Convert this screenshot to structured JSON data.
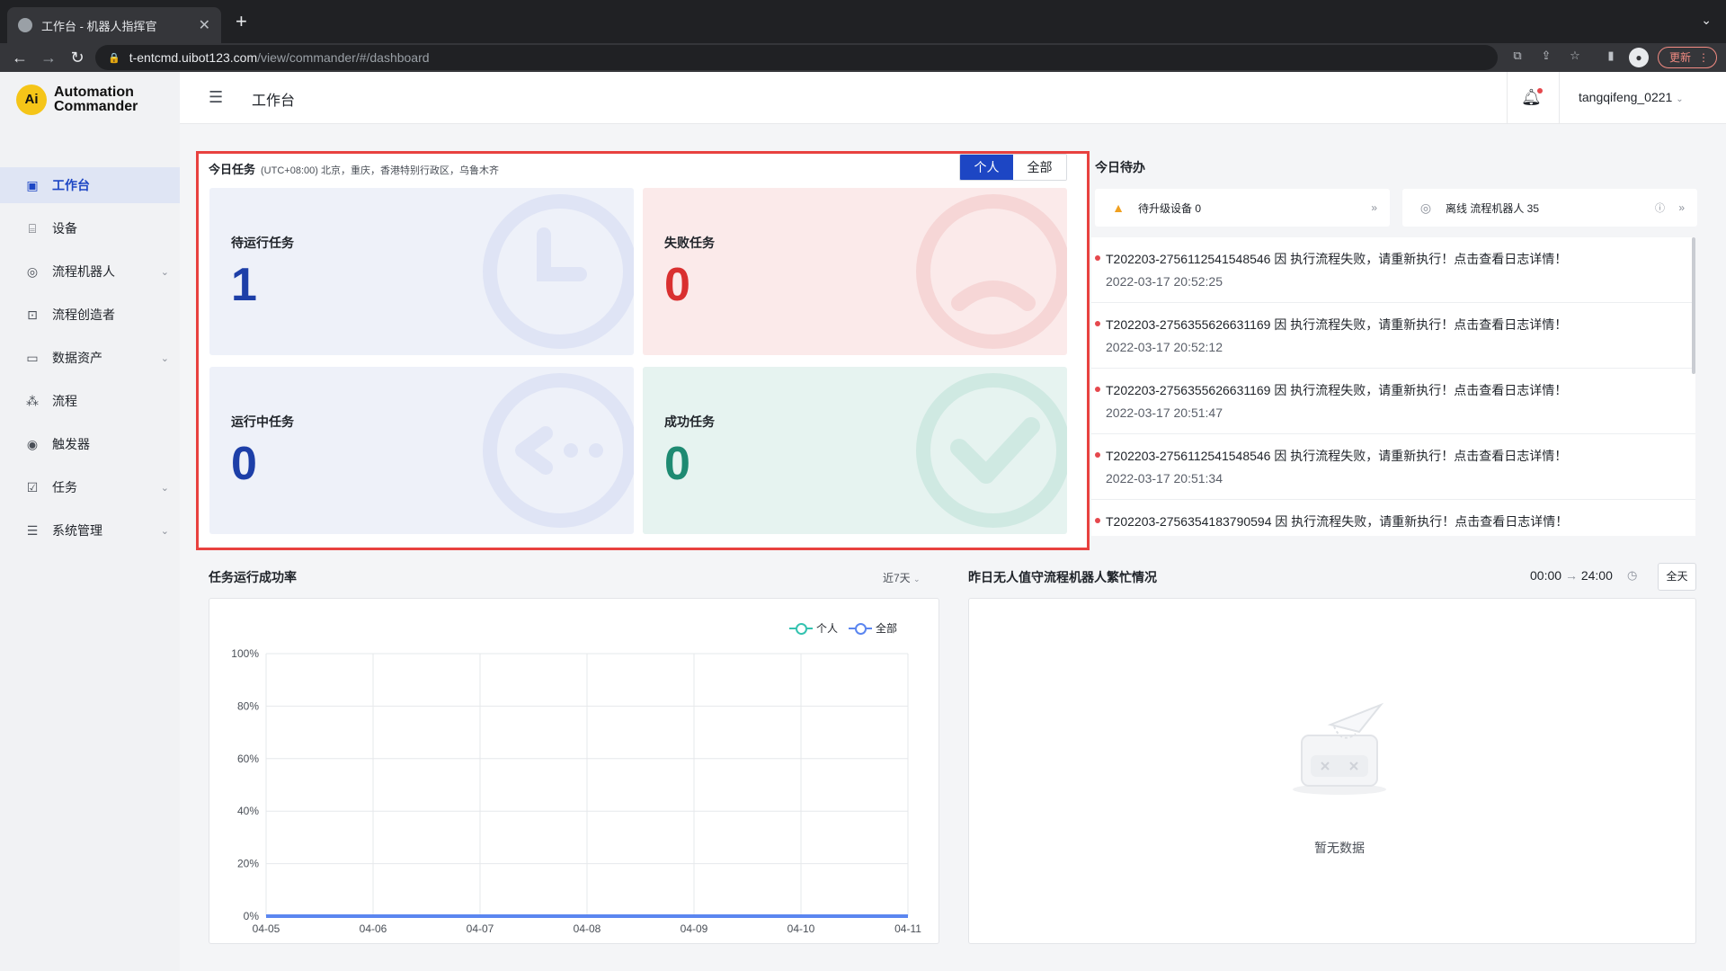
{
  "browser": {
    "tab_title": "工作台 - 机器人指挥官",
    "url_host": "t-entcmd.uibot123.com",
    "url_path": "/view/commander/#/dashboard",
    "update_label": "更新"
  },
  "app": {
    "logo_mark": "Ai",
    "logo_line1": "Automation",
    "logo_line2": "Commander"
  },
  "sidebar": {
    "items": [
      {
        "label": "工作台",
        "icon": "dashboard-icon",
        "active": true,
        "has_children": false
      },
      {
        "label": "设备",
        "icon": "device-icon",
        "active": false,
        "has_children": false
      },
      {
        "label": "流程机器人",
        "icon": "robot-icon",
        "active": false,
        "has_children": true
      },
      {
        "label": "流程创造者",
        "icon": "creator-icon",
        "active": false,
        "has_children": false
      },
      {
        "label": "数据资产",
        "icon": "folder-icon",
        "active": false,
        "has_children": true
      },
      {
        "label": "流程",
        "icon": "flow-icon",
        "active": false,
        "has_children": false
      },
      {
        "label": "触发器",
        "icon": "trigger-icon",
        "active": false,
        "has_children": false
      },
      {
        "label": "任务",
        "icon": "task-icon",
        "active": false,
        "has_children": true
      },
      {
        "label": "系统管理",
        "icon": "settings-icon",
        "active": false,
        "has_children": true
      }
    ]
  },
  "header": {
    "title": "工作台",
    "username": "tangqifeng_0221"
  },
  "today_tasks": {
    "title": "今日任务",
    "timezone": "(UTC+08:00) 北京，重庆，香港特别行政区，乌鲁木齐",
    "scope_options": [
      "个人",
      "全部"
    ],
    "scope_selected": "个人",
    "cards": {
      "pending": {
        "label": "待运行任务",
        "value": "1"
      },
      "failed": {
        "label": "失败任务",
        "value": "0"
      },
      "running": {
        "label": "运行中任务",
        "value": "0"
      },
      "success": {
        "label": "成功任务",
        "value": "0"
      }
    }
  },
  "todo": {
    "title": "今日待办",
    "chips": [
      {
        "icon": "upgrade-device-icon",
        "label": "待升级设备 0"
      },
      {
        "icon": "offline-robot-icon",
        "label": "离线 流程机器人 35"
      }
    ],
    "items": [
      {
        "message": "T202203-2756112541548546 因 执行流程失败，请重新执行！点击查看日志详情！",
        "time": "2022-03-17 20:52:25"
      },
      {
        "message": "T202203-2756355626631169 因 执行流程失败，请重新执行！点击查看日志详情！",
        "time": "2022-03-17 20:52:12"
      },
      {
        "message": "T202203-2756355626631169 因 执行流程失败，请重新执行！点击查看日志详情！",
        "time": "2022-03-17 20:51:47"
      },
      {
        "message": "T202203-2756112541548546 因 执行流程失败，请重新执行！点击查看日志详情！",
        "time": "2022-03-17 20:51:34"
      },
      {
        "message": "T202203-2756354183790594 因 执行流程失败，请重新执行！点击查看日志详情！",
        "time": ""
      }
    ]
  },
  "success_rate": {
    "title": "任务运行成功率",
    "period": "近7天"
  },
  "busy": {
    "title": "昨日无人值守流程机器人繁忙情况",
    "range_start": "00:00",
    "range_end": "24:00",
    "all_day_label": "全天",
    "empty_text": "暂无数据"
  },
  "colors": {
    "accent": "#1d46c4",
    "highlight_border": "#e8413f",
    "personal_series": "#35c3b0",
    "all_series": "#5b86f0"
  },
  "chart_data": {
    "type": "line",
    "categories": [
      "04-05",
      "04-06",
      "04-07",
      "04-08",
      "04-09",
      "04-10",
      "04-11"
    ],
    "series": [
      {
        "name": "个人",
        "values": [
          0,
          0,
          0,
          0,
          0,
          0,
          0
        ]
      },
      {
        "name": "全部",
        "values": [
          0,
          0,
          0,
          0,
          0,
          0,
          0
        ]
      }
    ],
    "yticks": [
      "0%",
      "20%",
      "40%",
      "60%",
      "80%",
      "100%"
    ],
    "ylim": [
      0,
      100
    ],
    "grid": true,
    "legend_position": "top-right"
  }
}
